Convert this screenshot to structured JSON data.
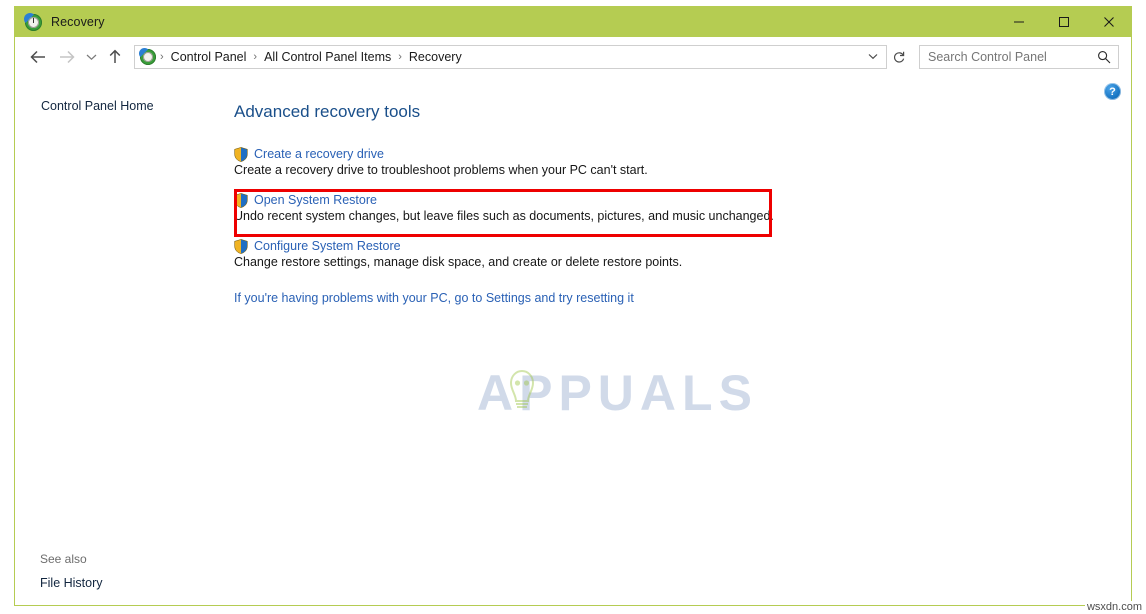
{
  "window": {
    "title": "Recovery",
    "title_icon": "recovery-icon",
    "accent_color": "#b5cc52",
    "controls": {
      "minimize": "minimize-button",
      "maximize": "maximize-button",
      "close": "close-button"
    }
  },
  "addressbar": {
    "back": "back-arrow-icon",
    "forward": "forward-arrow-icon",
    "history": "chevron-down-icon",
    "up": "up-arrow-icon",
    "breadcrumbs": [
      "Control Panel",
      "All Control Panel Items",
      "Recovery"
    ],
    "separator": "›",
    "dropdown": "⌄",
    "refresh": "refresh-icon"
  },
  "search": {
    "placeholder": "Search Control Panel",
    "icon": "search-icon"
  },
  "help": {
    "label": "?",
    "name": "help-button"
  },
  "sidebar": {
    "home_label": "Control Panel Home",
    "see_also_label": "See also",
    "file_history_label": "File History"
  },
  "main": {
    "heading": "Advanced recovery tools",
    "tasks": [
      {
        "link": "Create a recovery drive",
        "description": "Create a recovery drive to troubleshoot problems when your PC can't start.",
        "icon": "uac-shield-icon",
        "highlighted": false
      },
      {
        "link": "Open System Restore",
        "description": "Undo recent system changes, but leave files such as documents, pictures, and music unchanged.",
        "icon": "uac-shield-icon",
        "highlighted": true
      },
      {
        "link": "Configure System Restore",
        "description": "Change restore settings, manage disk space, and create or delete restore points.",
        "icon": "uac-shield-icon",
        "highlighted": false
      }
    ],
    "reset_link": "If you're having problems with your PC, go to Settings and try resetting it"
  },
  "annotation": {
    "color": "#ee0000",
    "target": "Open System Restore"
  },
  "watermarks": {
    "center": "APPUALS",
    "corner": "wsxdn.com"
  }
}
